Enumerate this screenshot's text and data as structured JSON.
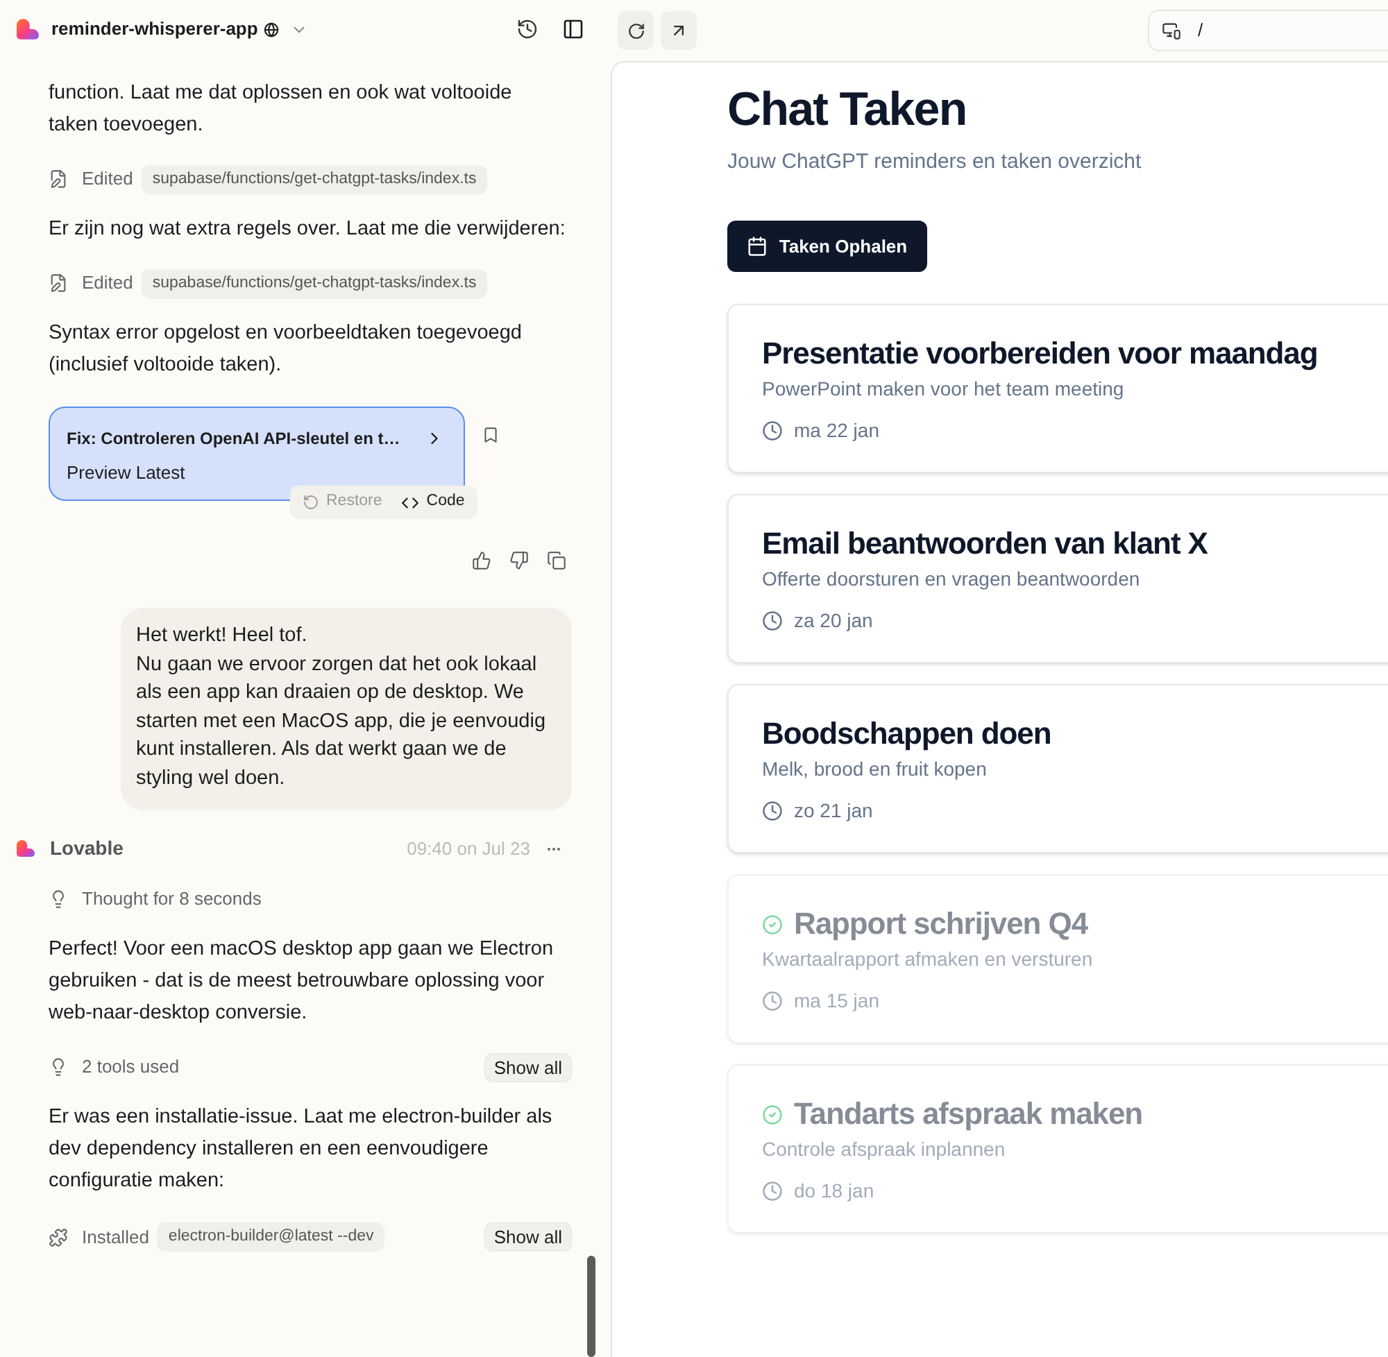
{
  "sidebar_header": {
    "project_name": "reminder-whisperer-app"
  },
  "chat": [
    {
      "kind": "text",
      "text": "function. Laat me dat oplossen en ook wat voltooide taken toevoegen."
    },
    {
      "kind": "edit",
      "verb": "Edited",
      "path": "supabase/functions/get-chatgpt-tasks/index.ts"
    },
    {
      "kind": "text",
      "text": "Er zijn nog wat extra regels over. Laat me die verwijderen:"
    },
    {
      "kind": "edit",
      "verb": "Edited",
      "path": "supabase/functions/get-chatgpt-tasks/index.ts"
    },
    {
      "kind": "text",
      "text": "Syntax error opgelost en voorbeeldtaken toegevoegd (inclusief voltooide taken)."
    },
    {
      "kind": "version",
      "title": "Fix: Controleren OpenAI API-sleutel en t…",
      "subtitle": "Preview Latest",
      "actions": [
        {
          "kind": "restore",
          "label": "Restore",
          "disabled": true
        },
        {
          "kind": "code",
          "label": "Code",
          "disabled": false
        }
      ]
    },
    {
      "kind": "feedback"
    },
    {
      "kind": "user",
      "paragraphs": [
        "Het werkt! Heel tof.",
        "Nu gaan we ervoor zorgen dat het ook lokaal als een app kan draaien op de desktop. We starten met een MacOS app, die je eenvoudig kunt installeren. Als dat werkt gaan we de styling wel doen."
      ]
    },
    {
      "kind": "author",
      "name": "Lovable",
      "time": "09:40 on Jul 23"
    },
    {
      "kind": "thought",
      "text": "Thought for 8 seconds"
    },
    {
      "kind": "text",
      "text": "Perfect! Voor een macOS desktop app gaan we Electron gebruiken - dat is de meest betrouwbare oplossing voor web-naar-desktop conversie."
    },
    {
      "kind": "tools",
      "text": "2 tools used",
      "button": "Show all"
    },
    {
      "kind": "text",
      "text": "Er was een installatie-issue. Laat me electron-builder als dev dependency installeren en een eenvoudigere configuratie maken:"
    },
    {
      "kind": "install",
      "verb": "Installed",
      "path": "electron-builder@latest --dev",
      "button": "Show all"
    }
  ],
  "preview_toolbar": {
    "address": "/"
  },
  "page": {
    "title": "Chat Taken",
    "subtitle": "Jouw ChatGPT reminders en taken overzicht",
    "button": "Taken Ophalen",
    "tasks": [
      {
        "title": "Presentatie voorbereiden voor maandag",
        "description": "PowerPoint maken voor het team meeting",
        "date": "ma 22 jan",
        "completed": false
      },
      {
        "title": "Email beantwoorden van klant X",
        "description": "Offerte doorsturen en vragen beantwoorden",
        "date": "za 20 jan",
        "completed": false
      },
      {
        "title": "Boodschappen doen",
        "description": "Melk, brood en fruit kopen",
        "date": "zo 21 jan",
        "completed": false
      },
      {
        "title": "Rapport schrijven Q4",
        "description": "Kwartaalrapport afmaken en versturen",
        "date": "ma 15 jan",
        "completed": true
      },
      {
        "title": "Tandarts afspraak maken",
        "description": "Controle afspraak inplannen",
        "date": "do 18 jan",
        "completed": true
      }
    ]
  }
}
